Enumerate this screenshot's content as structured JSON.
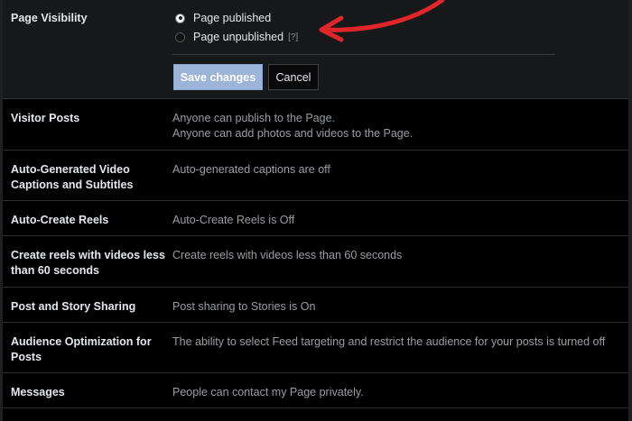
{
  "page_visibility": {
    "label": "Page Visibility",
    "options": [
      {
        "label": "Page published",
        "selected": true
      },
      {
        "label": "Page unpublished",
        "selected": false,
        "help": "[?]"
      }
    ],
    "save_label": "Save changes",
    "cancel_label": "Cancel"
  },
  "annotation": {
    "arrow_color": "#e0262a"
  },
  "rows": [
    {
      "label": "Visitor Posts",
      "value_lines": [
        "Anyone can publish to the Page.",
        "Anyone can add photos and videos to the Page."
      ]
    },
    {
      "label": "Auto-Generated Video Captions and Subtitles",
      "value_lines": [
        "Auto-generated captions are off"
      ]
    },
    {
      "label": "Auto-Create Reels",
      "value_lines": [
        "Auto-Create Reels is Off"
      ]
    },
    {
      "label": "Create reels with videos less than 60 seconds",
      "value_lines": [
        "Create reels with videos less than 60 seconds"
      ]
    },
    {
      "label": "Post and Story Sharing",
      "value_lines": [
        "Post sharing to Stories is On"
      ]
    },
    {
      "label": "Audience Optimization for Posts",
      "value_lines": [
        "The ability to select Feed targeting and restrict the audience for your posts is turned off"
      ]
    },
    {
      "label": "Messages",
      "value_lines": [
        "People can contact my Page privately."
      ]
    }
  ]
}
